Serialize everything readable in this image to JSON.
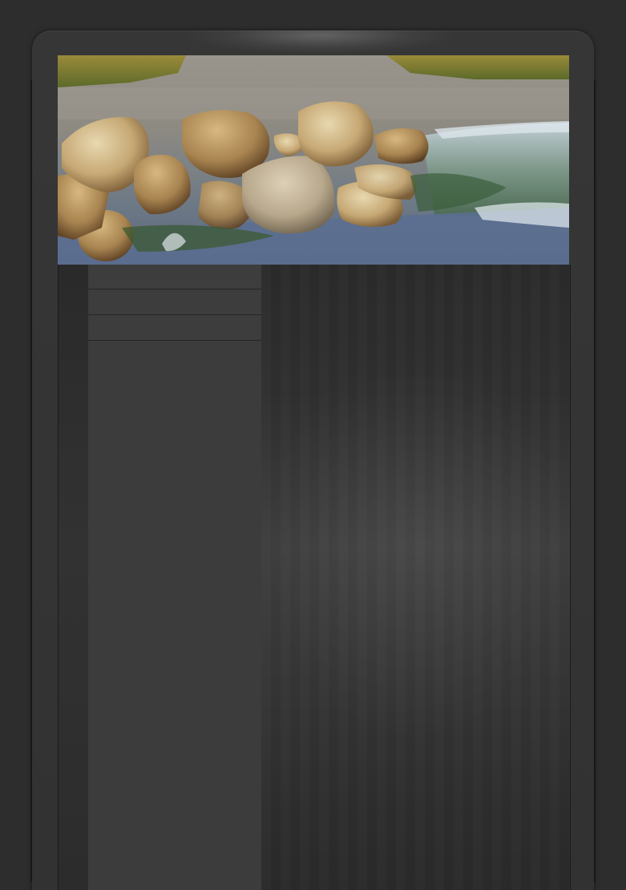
{
  "header": {
    "banner_image": "rocks-in-stream-photo"
  },
  "sidebar": {
    "items": [
      {
        "label": ""
      },
      {
        "label": ""
      },
      {
        "label": ""
      }
    ]
  },
  "colors": {
    "background": "#2d2d2d",
    "frame": "#353535",
    "sidebar": "#3c3c3c",
    "main": "#2f2f2f"
  }
}
